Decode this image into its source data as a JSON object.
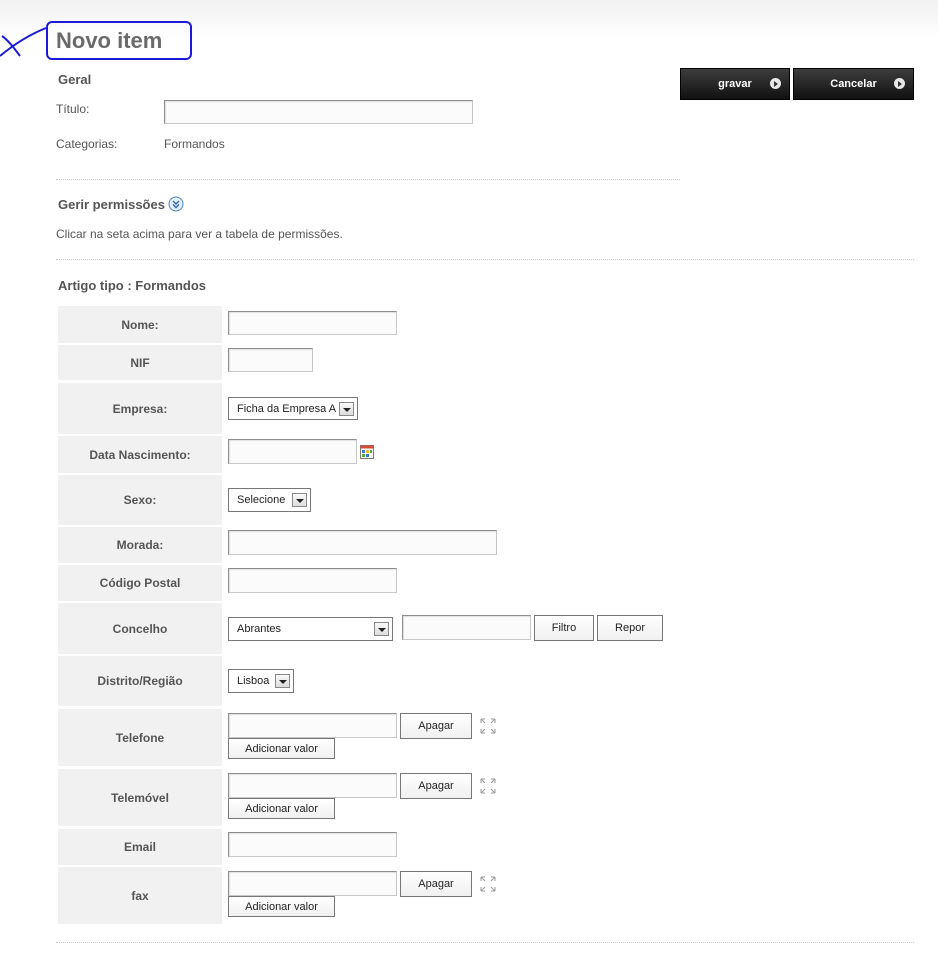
{
  "page": {
    "title": "Novo item"
  },
  "geral": {
    "heading": "Geral",
    "titulo_label": "Título:",
    "titulo_value": "",
    "categorias_label": "Categorias:",
    "categorias_value": "Formandos"
  },
  "actions": {
    "save_label": "gravar",
    "cancel_label": "Cancelar"
  },
  "permissions": {
    "heading": "Gerir permissões",
    "hint": "Clicar na seta acima para ver a tabela de permissões."
  },
  "article": {
    "heading": "Artigo tipo : Formandos",
    "fields": {
      "nome": "Nome:",
      "nif": "NIF",
      "empresa": "Empresa:",
      "data_nascimento": "Data Nascimento:",
      "sexo": "Sexo:",
      "morada": "Morada:",
      "codigo_postal": "Código Postal",
      "concelho": "Concelho",
      "distrito": "Distrito/Região",
      "telefone": "Telefone",
      "telemovel": "Telemóvel",
      "email": "Email",
      "fax": "fax"
    },
    "empresa_selected": "Ficha da Empresa A",
    "sexo_selected": "Selecione",
    "concelho_selected": "Abrantes",
    "distrito_selected": "Lisboa",
    "filtro_label": "Filtro",
    "repor_label": "Repor",
    "apagar_label": "Apagar",
    "adicionar_label": "Adicionar valor"
  }
}
